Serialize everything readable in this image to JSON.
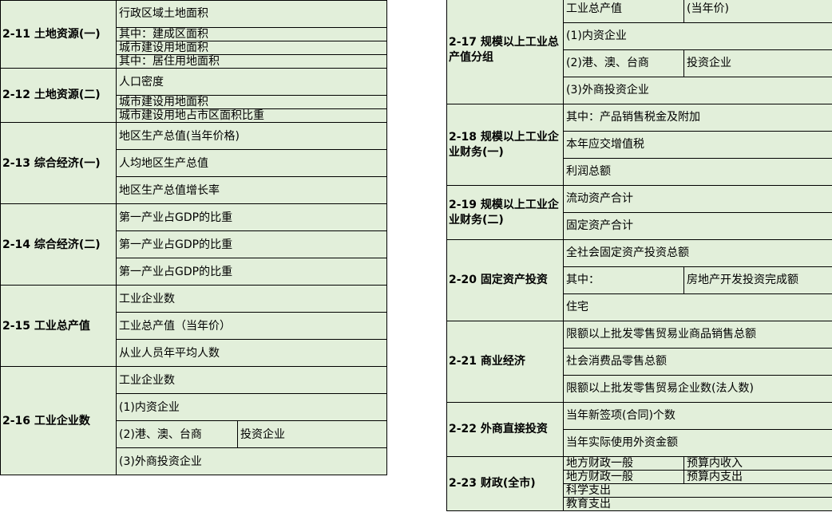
{
  "left_table": {
    "s211": {
      "title": "2-11 土地资源(一)",
      "rows": [
        "行政区域土地面积",
        "其中：建成区面积",
        "城市建设用地面积",
        "其中：居住用地面积"
      ]
    },
    "s212": {
      "title": "2-12 土地资源(二)",
      "rows": [
        "人口密度",
        "城市建设用地面积",
        "城市建设用地占市区面积比重"
      ]
    },
    "s213": {
      "title": "2-13 综合经济(一)",
      "rows": [
        "地区生产总值(当年价格)",
        "人均地区生产总值",
        "地区生产总值增长率"
      ]
    },
    "s214": {
      "title": "2-14 综合经济(二)",
      "rows": [
        "第一产业占GDP的比重",
        "第一产业占GDP的比重",
        "第一产业占GDP的比重"
      ]
    },
    "s215": {
      "title": "2-15 工业总产值",
      "rows": [
        "工业企业数",
        "工业总产值（当年价）",
        "从业人员年平均人数"
      ]
    },
    "s216": {
      "title": "2-16 工业企业数",
      "rows": [
        "工业企业数",
        "(1)内资企业",
        "(2)港、澳、台商",
        "(3)外商投资企业"
      ],
      "row3_right": "投资企业"
    }
  },
  "right_table": {
    "s217": {
      "title": "2-17 规模以上工业总产值分组",
      "rows": [
        "工业总产值",
        "(1)内资企业",
        "(2)港、澳、台商",
        "(3)外商投资企业"
      ],
      "row1_right": "(当年价)",
      "row3_right": "投资企业"
    },
    "s218": {
      "title": "2-18 规模以上工业企业财务(一)",
      "rows": [
        "其中：产品销售税金及附加",
        "本年应交增值税",
        "利润总额"
      ]
    },
    "s219": {
      "title": "2-19 规模以上工业企业财务(二)",
      "rows": [
        "流动资产合计",
        "固定资产合计"
      ]
    },
    "s220": {
      "title": "2-20 固定资产投资",
      "rows": [
        "全社会固定资产投资总额",
        "其中：",
        "住宅"
      ],
      "row2_right": "房地产开发投资完成额"
    },
    "s221": {
      "title": "2-21 商业经济",
      "rows": [
        "限额以上批发零售贸易业商品销售总额",
        "社会消费品零售总额",
        "限额以上批发零售贸易企业数(法人数)"
      ]
    },
    "s222": {
      "title": "2-22 外商直接投资",
      "rows": [
        "当年新签项(合同)个数",
        "当年实际使用外资金额"
      ]
    },
    "s223": {
      "title": "2-23 财政(全市)",
      "rows": [
        "地方财政一般",
        "地方财政一般",
        "科学支出",
        "教育支出"
      ],
      "row1_right": "预算内收入",
      "row2_right": "预算内支出"
    }
  }
}
